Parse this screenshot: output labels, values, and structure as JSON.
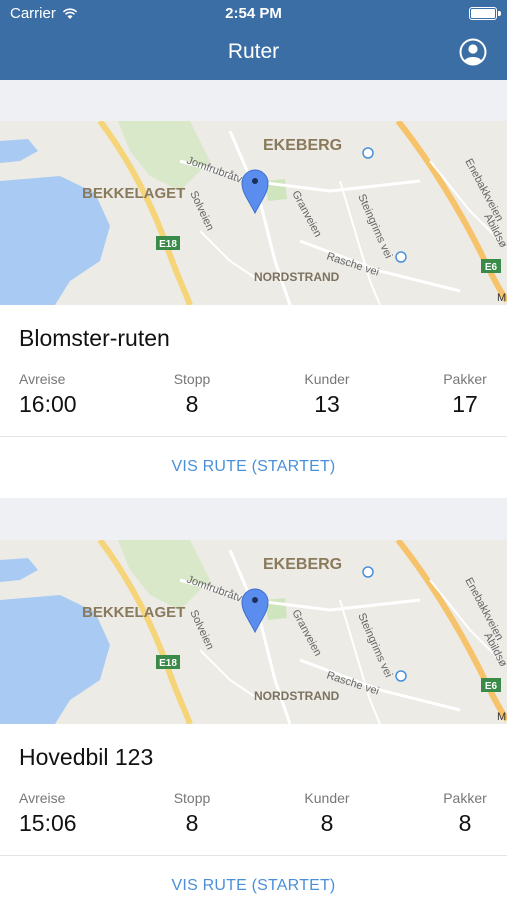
{
  "status_bar": {
    "carrier": "Carrier",
    "time": "2:54 PM"
  },
  "navbar": {
    "title": "Ruter"
  },
  "routes": [
    {
      "name": "Blomster-ruten",
      "stats": [
        {
          "label": "Avreise",
          "value": "16:00"
        },
        {
          "label": "Stopp",
          "value": "8"
        },
        {
          "label": "Kunder",
          "value": "13"
        },
        {
          "label": "Pakker",
          "value": "17"
        }
      ],
      "action_label": "VIS RUTE (STARTET)",
      "map": {
        "labels": {
          "ekeberg": "EKEBERG",
          "bekkelaget": "BEKKELAGET",
          "nordstrand": "NORDSTRAND",
          "jomfru": "Jomfrubråtveien",
          "solveien": "Solveien",
          "granveien": "Granveien",
          "rasche": "Rasche vei",
          "steingrims": "Steingrims vei",
          "enebakk": "Enebakkveien",
          "abilds": "Abildsø",
          "e18": "E18",
          "e6": "E6",
          "edge_m": "M"
        }
      }
    },
    {
      "name": "Hovedbil 123",
      "stats": [
        {
          "label": "Avreise",
          "value": "15:06"
        },
        {
          "label": "Stopp",
          "value": "8"
        },
        {
          "label": "Kunder",
          "value": "8"
        },
        {
          "label": "Pakker",
          "value": "8"
        }
      ],
      "action_label": "VIS RUTE (STARTET)",
      "map": {
        "labels": {
          "ekeberg": "EKEBERG",
          "bekkelaget": "BEKKELAGET",
          "nordstrand": "NORDSTRAND",
          "jomfru": "Jomfrubråtveien",
          "solveien": "Solveien",
          "granveien": "Granveien",
          "rasche": "Rasche vei",
          "steingrims": "Steingrims vei",
          "enebakk": "Enebakkveien",
          "abilds": "Abildsø",
          "e18": "E18",
          "e6": "E6",
          "edge_m": "M"
        }
      }
    }
  ],
  "colors": {
    "nav": "#3a6ea5",
    "accent": "#4a90d9",
    "water": "#a9cbf3",
    "pin": "#5b8def"
  },
  "icons": {
    "wifi": "wifi-icon",
    "battery": "battery-icon",
    "profile": "profile-icon",
    "pin": "map-pin-icon"
  }
}
